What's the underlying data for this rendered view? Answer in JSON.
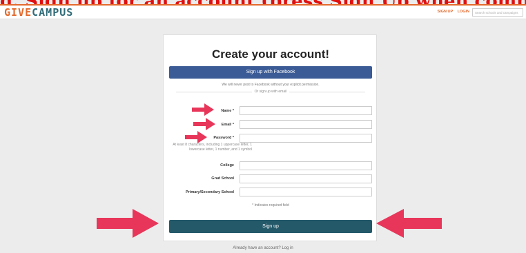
{
  "annotation_banner": "g. Sign up for an account (press Sign Up when complete)",
  "header": {
    "logo_give": "GIVE",
    "logo_campus": "CAMPUS",
    "links": [
      "SIGN UP",
      "LOGIN"
    ],
    "search_placeholder": "Search schools and campaigns"
  },
  "form": {
    "title": "Create your account!",
    "facebook_button": "Sign up with Facebook",
    "facebook_note": "We will never post to Facebook without your explicit permission.",
    "divider_text": "Or sign up with email",
    "fields": {
      "name": "Name *",
      "email": "Email *",
      "password": "Password *",
      "college": "College",
      "grad_school": "Grad School",
      "primary_school": "Primary/Secondary School"
    },
    "password_hint": "At least 8 characters, including 1 uppercase letter, 1 lowercase letter, 1 number, and 1 symbol",
    "required_note": "* Indicates required field",
    "submit": "Sign up"
  },
  "footer": {
    "login_prompt": "Already have an account? Log in"
  },
  "colors": {
    "accent_orange": "#e36a2c",
    "brand_teal": "#2f6b78",
    "facebook_blue": "#3b5b96",
    "submit_teal": "#24596a",
    "annotation_arrow": "#e8365a"
  }
}
